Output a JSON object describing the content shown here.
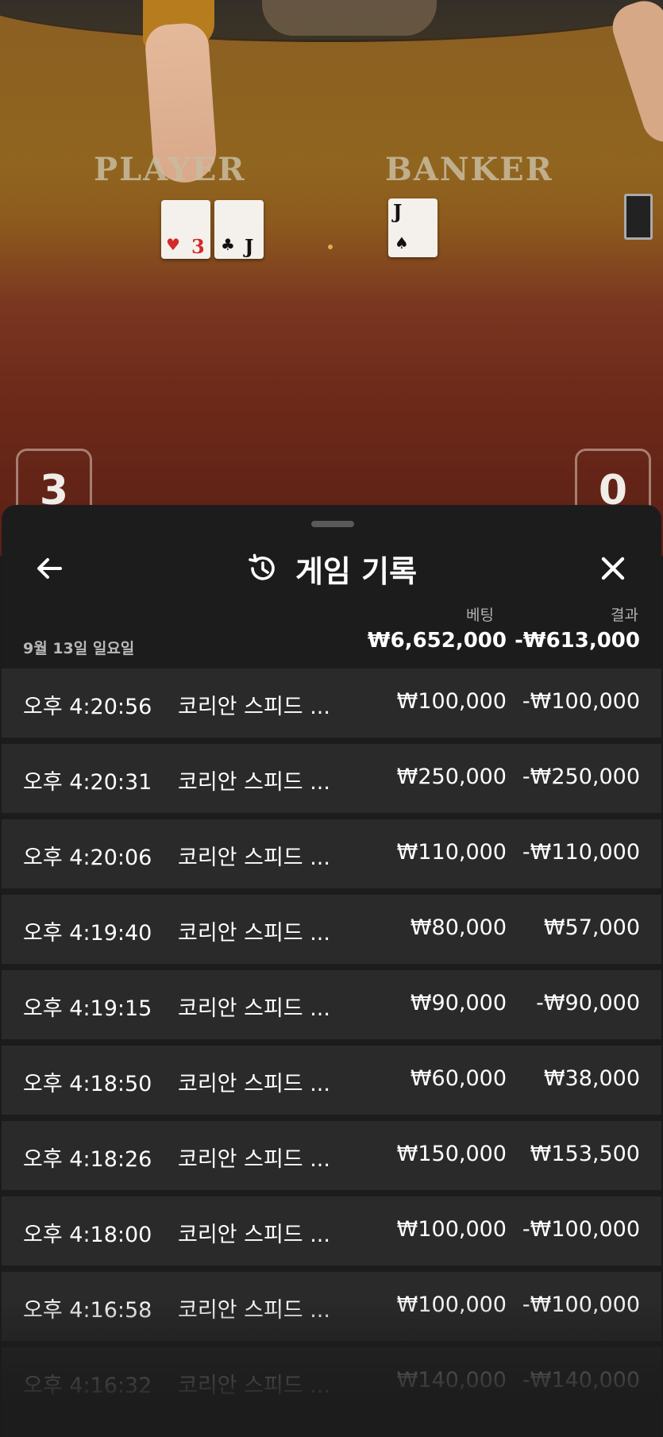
{
  "table": {
    "player_label": "PLAYER",
    "banker_label": "BANKER",
    "player_score": "3",
    "banker_score": "0",
    "player_cards": [
      {
        "rank": "3",
        "suit": "♥",
        "color": "#d42a2a"
      },
      {
        "rank": "J",
        "suit": "♣",
        "color": "#111111"
      }
    ],
    "banker_cards": [
      {
        "rank": "J",
        "suit": "♠",
        "color": "#111111"
      }
    ]
  },
  "sheet": {
    "title": "게임 기록",
    "back_icon": "arrow-left-icon",
    "history_icon": "history-clock-icon",
    "close_icon": "close-icon",
    "col_bet": "베팅",
    "col_result": "결과",
    "summary": {
      "date": "9월 13일 일요일",
      "total_bet": "₩6,652,000",
      "total_result": "-₩613,000"
    },
    "rows": [
      {
        "time": "오후 4:20:56",
        "game": "코리안 스피드 ...",
        "bet": "₩100,000",
        "result": "-₩100,000"
      },
      {
        "time": "오후 4:20:31",
        "game": "코리안 스피드 ...",
        "bet": "₩250,000",
        "result": "-₩250,000"
      },
      {
        "time": "오후 4:20:06",
        "game": "코리안 스피드 ...",
        "bet": "₩110,000",
        "result": "-₩110,000"
      },
      {
        "time": "오후 4:19:40",
        "game": "코리안 스피드 ...",
        "bet": "₩80,000",
        "result": "₩57,000"
      },
      {
        "time": "오후 4:19:15",
        "game": "코리안 스피드 ...",
        "bet": "₩90,000",
        "result": "-₩90,000"
      },
      {
        "time": "오후 4:18:50",
        "game": "코리안 스피드 ...",
        "bet": "₩60,000",
        "result": "₩38,000"
      },
      {
        "time": "오후 4:18:26",
        "game": "코리안 스피드 ...",
        "bet": "₩150,000",
        "result": "₩153,500"
      },
      {
        "time": "오후 4:18:00",
        "game": "코리안 스피드 ...",
        "bet": "₩100,000",
        "result": "-₩100,000"
      },
      {
        "time": "오후 4:16:58",
        "game": "코리안 스피드 ...",
        "bet": "₩100,000",
        "result": "-₩100,000"
      },
      {
        "time": "오후 4:16:32",
        "game": "코리안 스피드 ...",
        "bet": "₩140,000",
        "result": "-₩140,000"
      }
    ]
  }
}
